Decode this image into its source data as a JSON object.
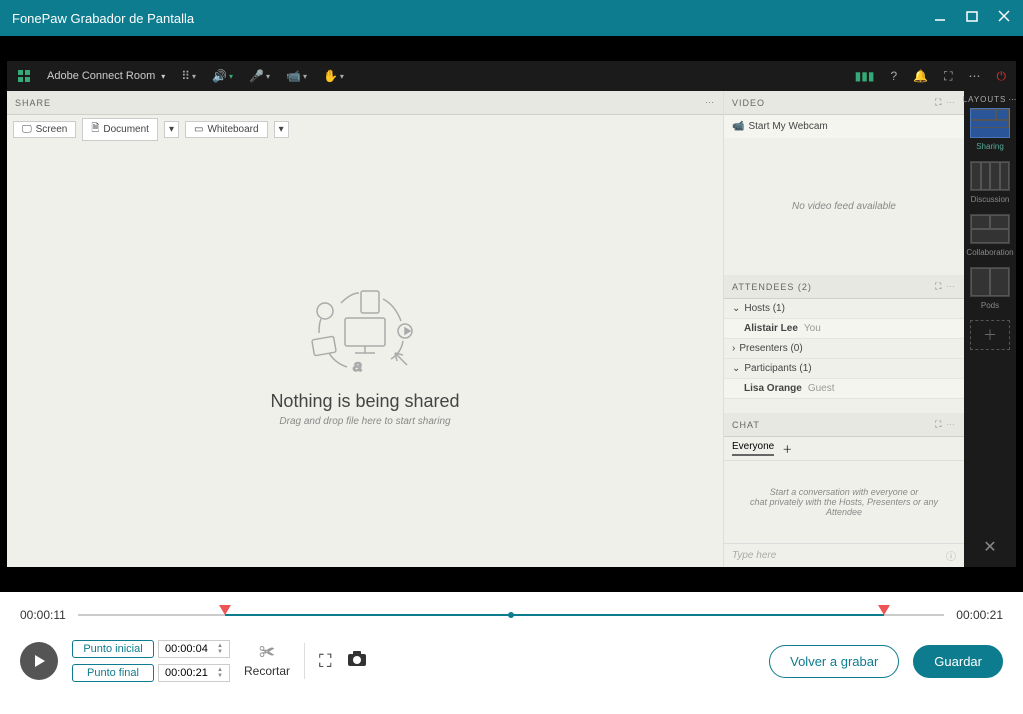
{
  "titlebar": {
    "title": "FonePaw Grabador de Pantalla"
  },
  "app": {
    "room_name": "Adobe Connect Room",
    "share": {
      "header": "SHARE",
      "screen_btn": "Screen",
      "document_btn": "Document",
      "whiteboard_btn": "Whiteboard",
      "empty_title": "Nothing is being shared",
      "empty_sub": "Drag and drop file here to start sharing"
    },
    "video": {
      "header": "VIDEO",
      "start_webcam": "Start My Webcam",
      "no_feed": "No video feed available"
    },
    "attendees": {
      "header": "ATTENDEES  (2)",
      "hosts_label": "Hosts (1)",
      "host_name": "Alistair Lee",
      "host_role": "You",
      "presenters_label": "Presenters (0)",
      "participants_label": "Participants (1)",
      "participant_name": "Lisa Orange",
      "participant_role": "Guest"
    },
    "chat": {
      "header": "CHAT",
      "tab": "Everyone",
      "msg1": "Start a conversation with everyone or",
      "msg2": "chat privately with the Hosts, Presenters or any Attendee",
      "placeholder": "Type here"
    },
    "layouts": {
      "header": "LAYOUTS",
      "sharing": "Sharing",
      "discussion": "Discussion",
      "collaboration": "Collaboration",
      "pods": "Pods"
    }
  },
  "recorder": {
    "time_start": "00:00:11",
    "time_end": "00:00:21",
    "punto_inicial_label": "Punto inicial",
    "punto_inicial_val": "00:00:04",
    "punto_final_label": "Punto final",
    "punto_final_val": "00:00:21",
    "recortar": "Recortar",
    "volver": "Volver a grabar",
    "guardar": "Guardar"
  }
}
